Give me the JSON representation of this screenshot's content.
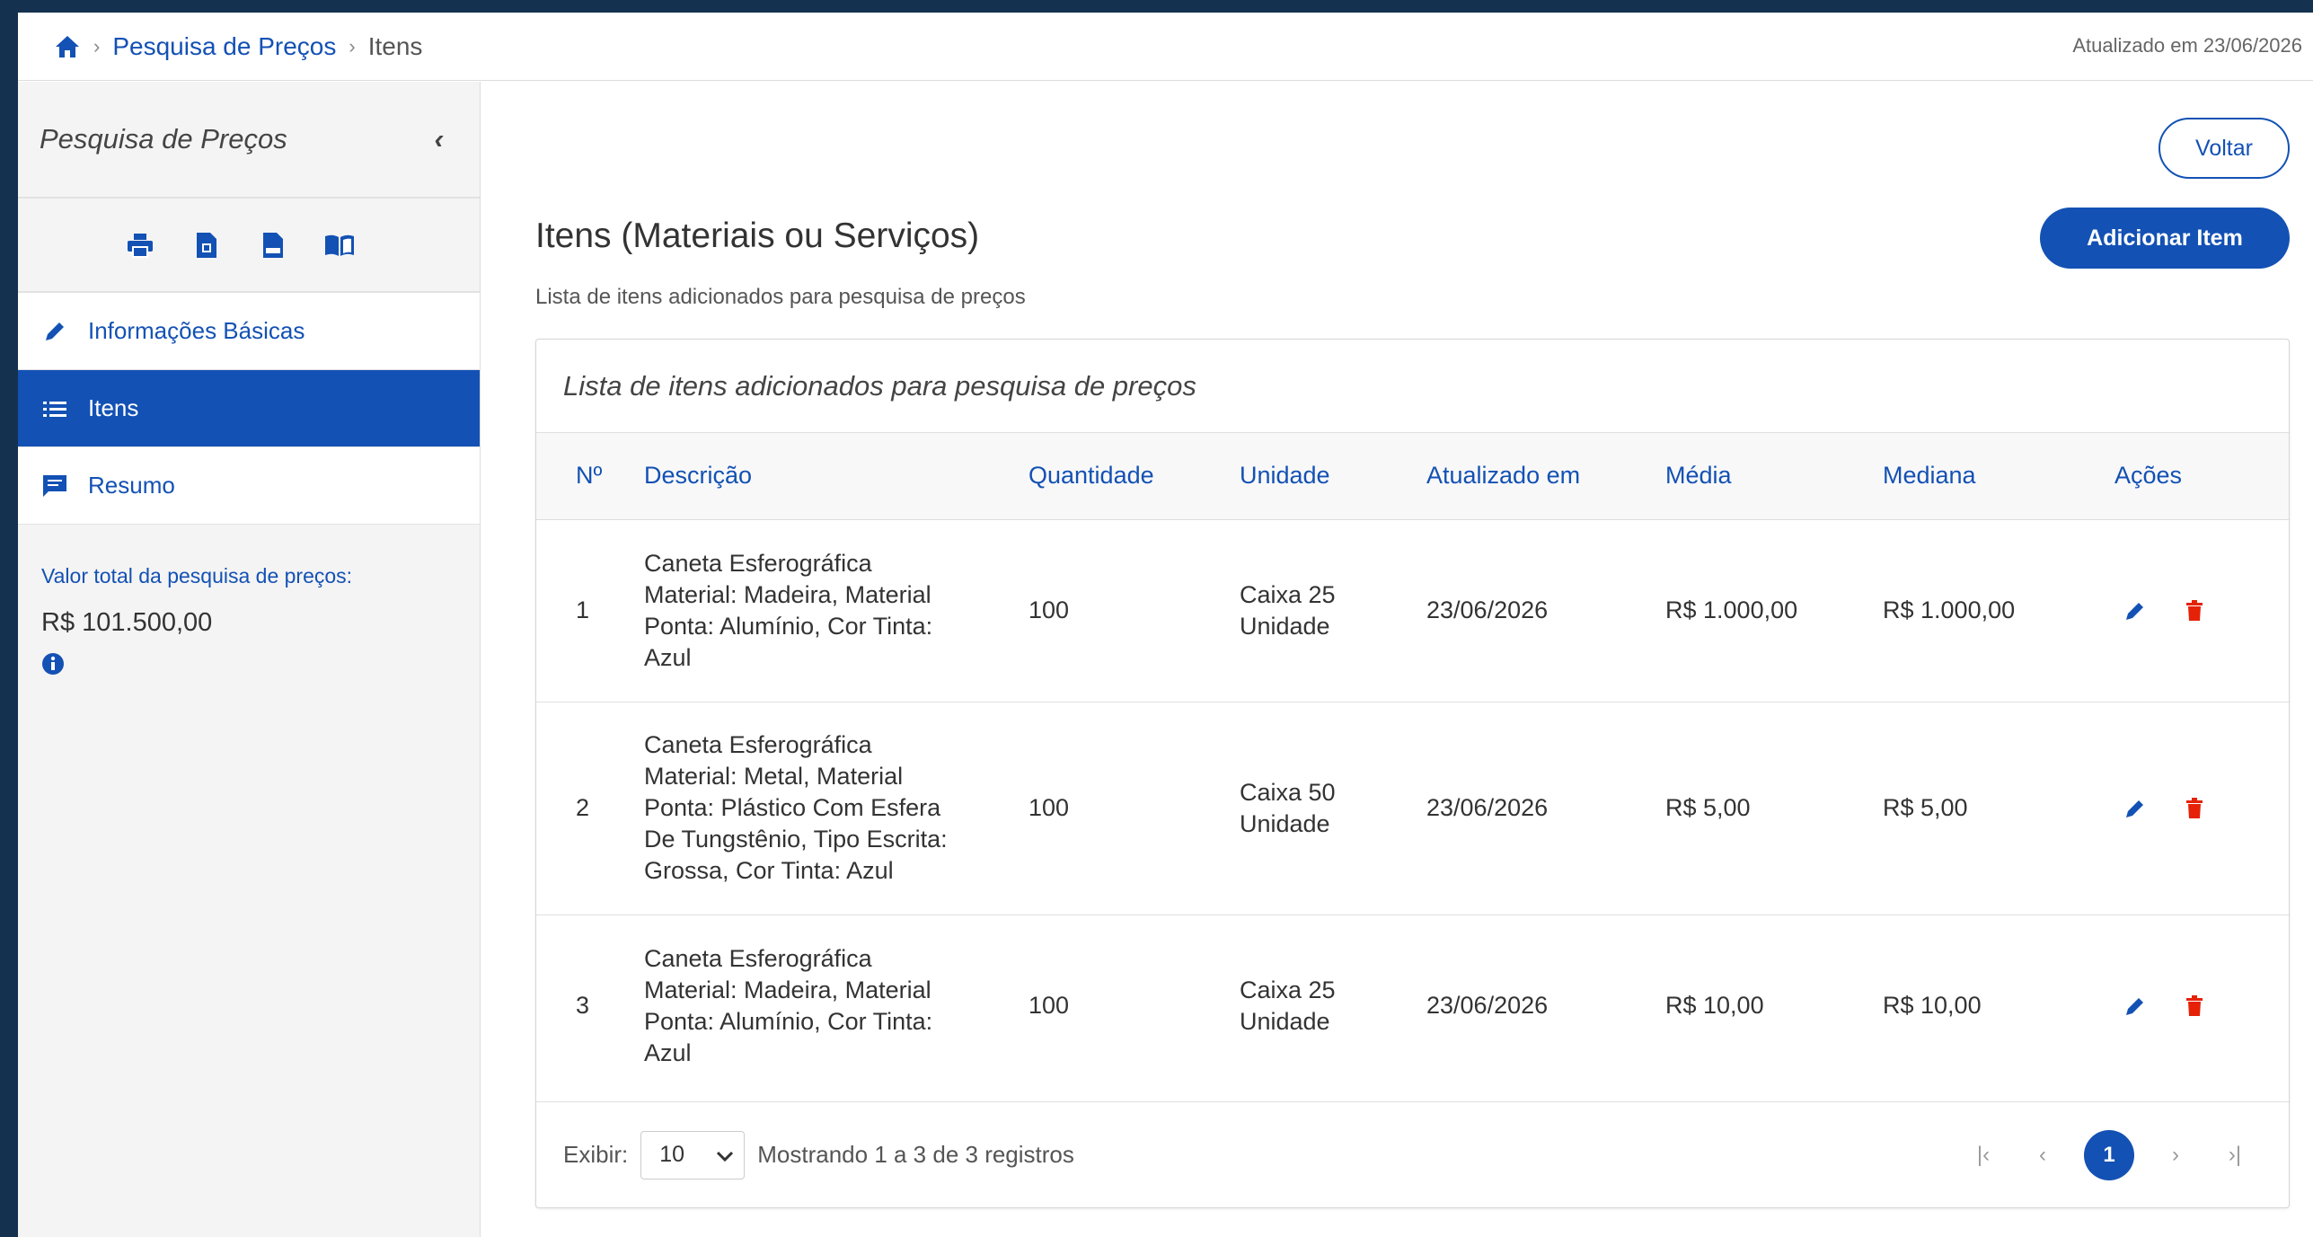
{
  "breadcrumb": {
    "items": [
      "Pesquisa de Preços",
      "Itens"
    ],
    "separator": "›"
  },
  "header": {
    "updated": "Atualizado em 23/06/2026"
  },
  "sidebar": {
    "title": "Pesquisa de Preços",
    "collapse_glyph": "‹",
    "tool_icons": [
      "print-icon",
      "pdf-file-icon",
      "csv-file-icon",
      "book-icon"
    ],
    "items": [
      {
        "label": "Informações Básicas",
        "icon": "pencil-icon",
        "active": false
      },
      {
        "label": "Itens",
        "icon": "list-icon",
        "active": true
      },
      {
        "label": "Resumo",
        "icon": "comment-icon",
        "active": false
      }
    ],
    "total_label": "Valor total da pesquisa de preços:",
    "total_value": "R$ 101.500,00"
  },
  "main": {
    "voltar_label": "Voltar",
    "add_label": "Adicionar Item",
    "title": "Itens (Materiais ou Serviços)",
    "subtitle": "Lista de itens adicionados para pesquisa de preços",
    "table": {
      "caption": "Lista de itens adicionados para pesquisa de preços",
      "headers": [
        "Nº",
        "Descrição",
        "Quantidade",
        "Unidade",
        "Atualizado em",
        "Média",
        "Mediana",
        "Ações"
      ],
      "rows": [
        {
          "n": "1",
          "desc": "Caneta Esferográfica Material: Madeira, Material Ponta: Alumínio, Cor Tinta: Azul",
          "qty": "100",
          "unit": "Caixa 25 Unidade",
          "updated": "23/06/2026",
          "media": "R$ 1.000,00",
          "mediana": "R$ 1.000,00"
        },
        {
          "n": "2",
          "desc": "Caneta Esferográfica Material: Metal, Material Ponta: Plástico Com Esfera De Tungstênio, Tipo Escrita: Grossa, Cor Tinta: Azul",
          "qty": "100",
          "unit": "Caixa 50 Unidade",
          "updated": "23/06/2026",
          "media": "R$ 5,00",
          "mediana": "R$ 5,00"
        },
        {
          "n": "3",
          "desc": "Caneta Esferográfica Material: Madeira, Material Ponta: Alumínio, Cor Tinta: Azul",
          "qty": "100",
          "unit": "Caixa 25 Unidade",
          "updated": "23/06/2026",
          "media": "R$ 10,00",
          "mediana": "R$ 10,00"
        }
      ]
    },
    "footer": {
      "show_label": "Exibir:",
      "page_size": "10",
      "info": "Mostrando 1 a 3 de 3 registros",
      "current_page": "1",
      "nav": {
        "first": "|‹",
        "prev": "‹",
        "next": "›",
        "last": "›|"
      }
    }
  },
  "colors": {
    "primary": "#1351b4",
    "danger": "#e52207",
    "frame": "#14324f"
  }
}
